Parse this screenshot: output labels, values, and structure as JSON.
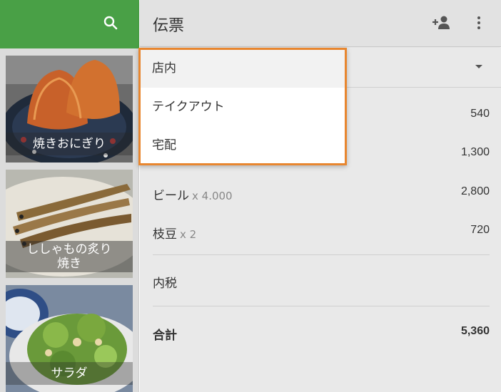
{
  "sidebar": {
    "search_icon": "search-icon",
    "accent_color": "#49a046",
    "items": [
      {
        "label": "焼きおにぎり"
      },
      {
        "label": "ししゃもの炙り焼き"
      },
      {
        "label": "サラダ"
      }
    ]
  },
  "header": {
    "title": "伝票",
    "icons": [
      "add-person-icon",
      "more-vert-icon"
    ]
  },
  "dropdown": {
    "highlight_color": "#e8862f",
    "options": [
      {
        "label": "店内",
        "selected": true
      },
      {
        "label": "テイクアウト",
        "selected": false
      },
      {
        "label": "宅配",
        "selected": false
      }
    ]
  },
  "order": {
    "items": [
      {
        "name": "",
        "qty": "",
        "price": "540"
      },
      {
        "name": "",
        "qty": "",
        "price": "1,300"
      },
      {
        "name": "ビール",
        "qty": "x 4.000",
        "price": "2,800"
      },
      {
        "name": "枝豆",
        "qty": "x 2",
        "price": "720"
      }
    ],
    "tax_label": "内税",
    "total_label": "合計",
    "total_value": "5,360"
  }
}
